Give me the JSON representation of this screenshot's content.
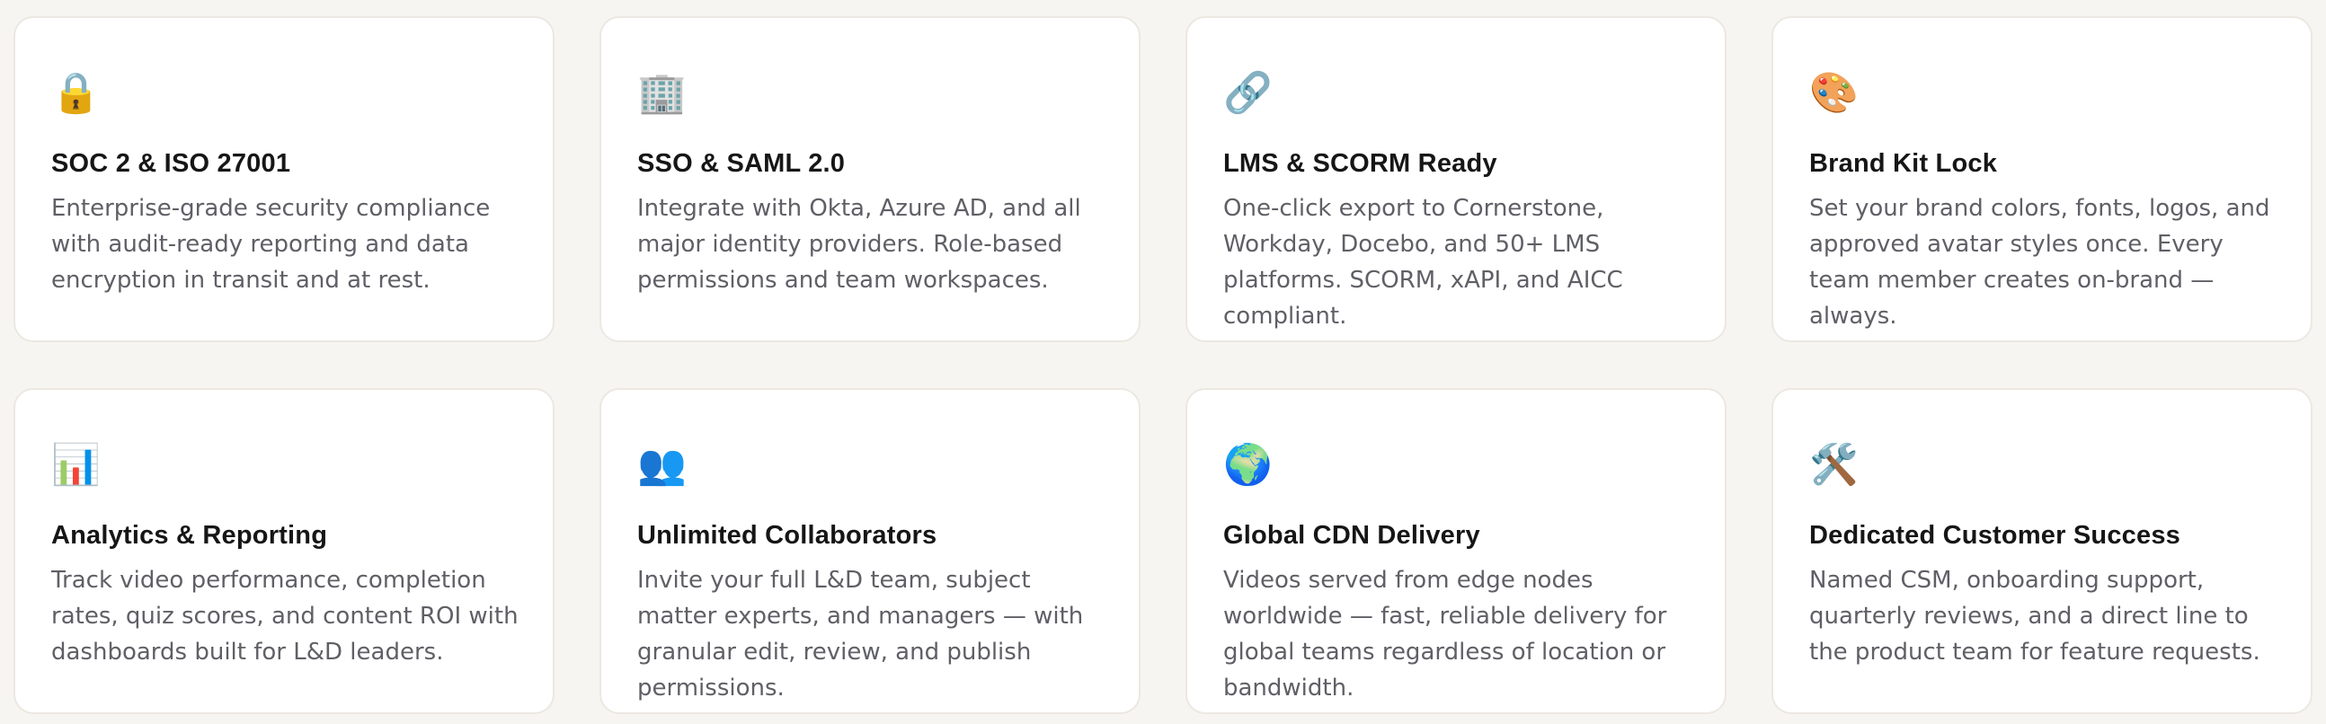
{
  "features": [
    {
      "icon": "🔒",
      "icon_name": "lock-icon",
      "title": "SOC 2 & ISO 27001",
      "description": "Enterprise-grade security compliance with audit-ready reporting and data encryption in transit and at rest."
    },
    {
      "icon": "🏢",
      "icon_name": "office-building-icon",
      "title": "SSO & SAML 2.0",
      "description": "Integrate with Okta, Azure AD, and all major identity providers. Role-based permissions and team workspaces."
    },
    {
      "icon": "🔗",
      "icon_name": "link-icon",
      "title": "LMS & SCORM Ready",
      "description": "One-click export to Cornerstone, Workday, Docebo, and 50+ LMS platforms. SCORM, xAPI, and AICC compliant."
    },
    {
      "icon": "🎨",
      "icon_name": "artist-palette-icon",
      "title": "Brand Kit Lock",
      "description": "Set your brand colors, fonts, logos, and approved avatar styles once. Every team member creates on-brand — always."
    },
    {
      "icon": "📊",
      "icon_name": "bar-chart-icon",
      "title": "Analytics & Reporting",
      "description": "Track video performance, completion rates, quiz scores, and content ROI with dashboards built for L&D leaders."
    },
    {
      "icon": "👥",
      "icon_name": "people-icon",
      "title": "Unlimited Collaborators",
      "description": "Invite your full L&D team, subject matter experts, and managers — with granular edit, review, and publish permissions."
    },
    {
      "icon": "🌍",
      "icon_name": "globe-icon",
      "title": "Global CDN Delivery",
      "description": "Videos served from edge nodes worldwide — fast, reliable delivery for global teams regardless of location or bandwidth."
    },
    {
      "icon": "🛠️",
      "icon_name": "hammer-and-wrench-icon",
      "title": "Dedicated Customer Success",
      "description": "Named CSM, onboarding support, quarterly reviews, and a direct line to the product team for feature requests."
    }
  ]
}
